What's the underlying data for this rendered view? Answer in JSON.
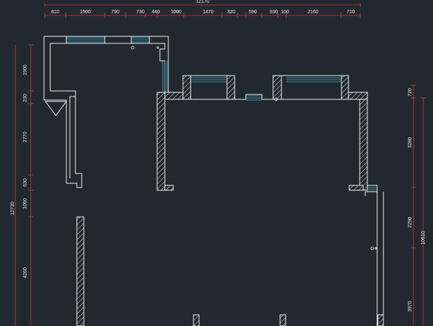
{
  "top_dims": {
    "overall": "12170",
    "segments": [
      "810",
      "1500",
      "790",
      "730",
      "440",
      "1000",
      "1470",
      "320",
      "590",
      "930",
      "100",
      "2160",
      "710"
    ]
  },
  "left_dims": {
    "overall": "12730",
    "segments": [
      "1900",
      "230",
      "2770",
      "630",
      "1090",
      "4260"
    ]
  },
  "right_dims": {
    "overall": "10610",
    "segments": [
      "720",
      "3280",
      "2290",
      "3970"
    ]
  },
  "colors": {
    "background": "#212830",
    "dimension": "#d23a3a",
    "wall": "#f2f2f2",
    "window": "#4fb8c8"
  }
}
